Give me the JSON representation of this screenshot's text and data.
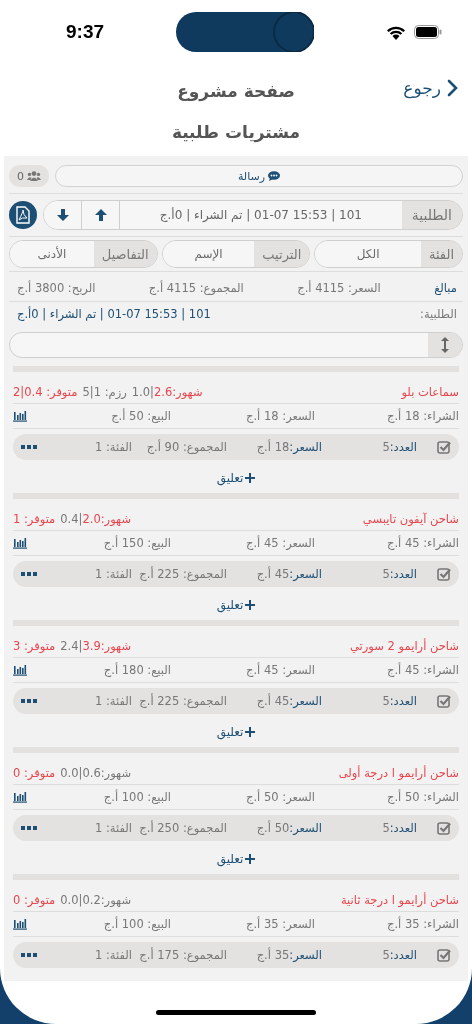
{
  "status_bar": {
    "time": "9:37"
  },
  "nav": {
    "back": "رجوع",
    "title": "صفحة مشروع"
  },
  "subtitle": "مشتريات طلبية",
  "message_button": "رسالة",
  "members_count": "0",
  "order_bar": {
    "label": "الطلبية",
    "text": "101 | 15:53 01-07 | تم الشراء | 0أ.ج"
  },
  "filters": [
    {
      "label": "الفئة",
      "value": "الكل"
    },
    {
      "label": "الترتيب",
      "value": "الإسم"
    },
    {
      "label": "التفاصيل",
      "value": "الأدنى"
    }
  ],
  "summary": {
    "title": "مبالغ",
    "price": "السعر: 4115 أ.ج",
    "total": "المجموع: 4115 أ.ج",
    "profit": "الربح: 3800 أ.ج"
  },
  "order_line": {
    "label": "الطلبية:",
    "value": "101 | 15:53 01-07 | تم الشراء | 0أ.ج"
  },
  "items": [
    {
      "name": "سماعات بلو",
      "stats": [
        {
          "text": "شهور:2.6",
          "alert": true
        },
        {
          "text": "|1.0",
          "alert": false
        },
        {
          "text": "رزم: 1|5",
          "alert": false
        },
        {
          "text": "متوفر: 0.4|2",
          "alert": true
        }
      ],
      "buy": "الشراء: 18 أ.ج",
      "price": "السعر: 18 أ.ج",
      "sell": "البيع: 50 أ.ج",
      "checked": true,
      "qty_label": "العدد:",
      "qty": "5",
      "unit_label": "السعر:",
      "unit": "18 أ.ج",
      "total": "المجموع: 90 أ.ج",
      "category": "الفئة: 1",
      "comment": "تعليق"
    },
    {
      "name": "شاحن آيفون تايبسي",
      "stats": [
        {
          "text": "شهور:2.0",
          "alert": true
        },
        {
          "text": "|0.4",
          "alert": false
        },
        {
          "text": "متوفر: 1",
          "alert": true
        }
      ],
      "buy": "الشراء: 45 أ.ج",
      "price": "السعر: 45 أ.ج",
      "sell": "البيع: 150 أ.ج",
      "checked": true,
      "qty_label": "العدد:",
      "qty": "5",
      "unit_label": "السعر:",
      "unit": "45 أ.ج",
      "total": "المجموع: 225 أ.ج",
      "category": "الفئة: 1",
      "comment": "تعليق"
    },
    {
      "name": "شاحن أرايمو 2 سورتي",
      "stats": [
        {
          "text": "شهور:3.9",
          "alert": true
        },
        {
          "text": "|2.4",
          "alert": false
        },
        {
          "text": "متوفر: 3",
          "alert": true
        }
      ],
      "buy": "الشراء: 45 أ.ج",
      "price": "السعر: 45 أ.ج",
      "sell": "البيع: 180 أ.ج",
      "checked": true,
      "qty_label": "العدد:",
      "qty": "5",
      "unit_label": "السعر:",
      "unit": "45 أ.ج",
      "total": "المجموع: 225 أ.ج",
      "category": "الفئة: 1",
      "comment": "تعليق"
    },
    {
      "name": "شاحن أرايمو ا درجة أولى",
      "stats": [
        {
          "text": "شهور:0.6",
          "alert": false
        },
        {
          "text": "|0.0",
          "alert": false
        },
        {
          "text": "متوفر: 0",
          "alert": true
        }
      ],
      "buy": "الشراء: 50 أ.ج",
      "price": "السعر: 50 أ.ج",
      "sell": "البيع: 100 أ.ج",
      "checked": true,
      "qty_label": "العدد:",
      "qty": "5",
      "unit_label": "السعر:",
      "unit": "50 أ.ج",
      "total": "المجموع: 250 أ.ج",
      "category": "الفئة: 1",
      "comment": "تعليق"
    },
    {
      "name": "شاحن أرايمو ا درجة ثانية",
      "stats": [
        {
          "text": "شهور:0.2",
          "alert": false
        },
        {
          "text": "|0.0",
          "alert": false
        },
        {
          "text": "متوفر: 0",
          "alert": true
        }
      ],
      "buy": "الشراء: 35 أ.ج",
      "price": "السعر: 35 أ.ج",
      "sell": "البيع: 100 أ.ج",
      "checked": true,
      "qty_label": "العدد:",
      "qty": "5",
      "unit_label": "السعر:",
      "unit": "35 أ.ج",
      "total": "المجموع: 175 أ.ج",
      "category": "الفئة: 1"
    }
  ]
}
